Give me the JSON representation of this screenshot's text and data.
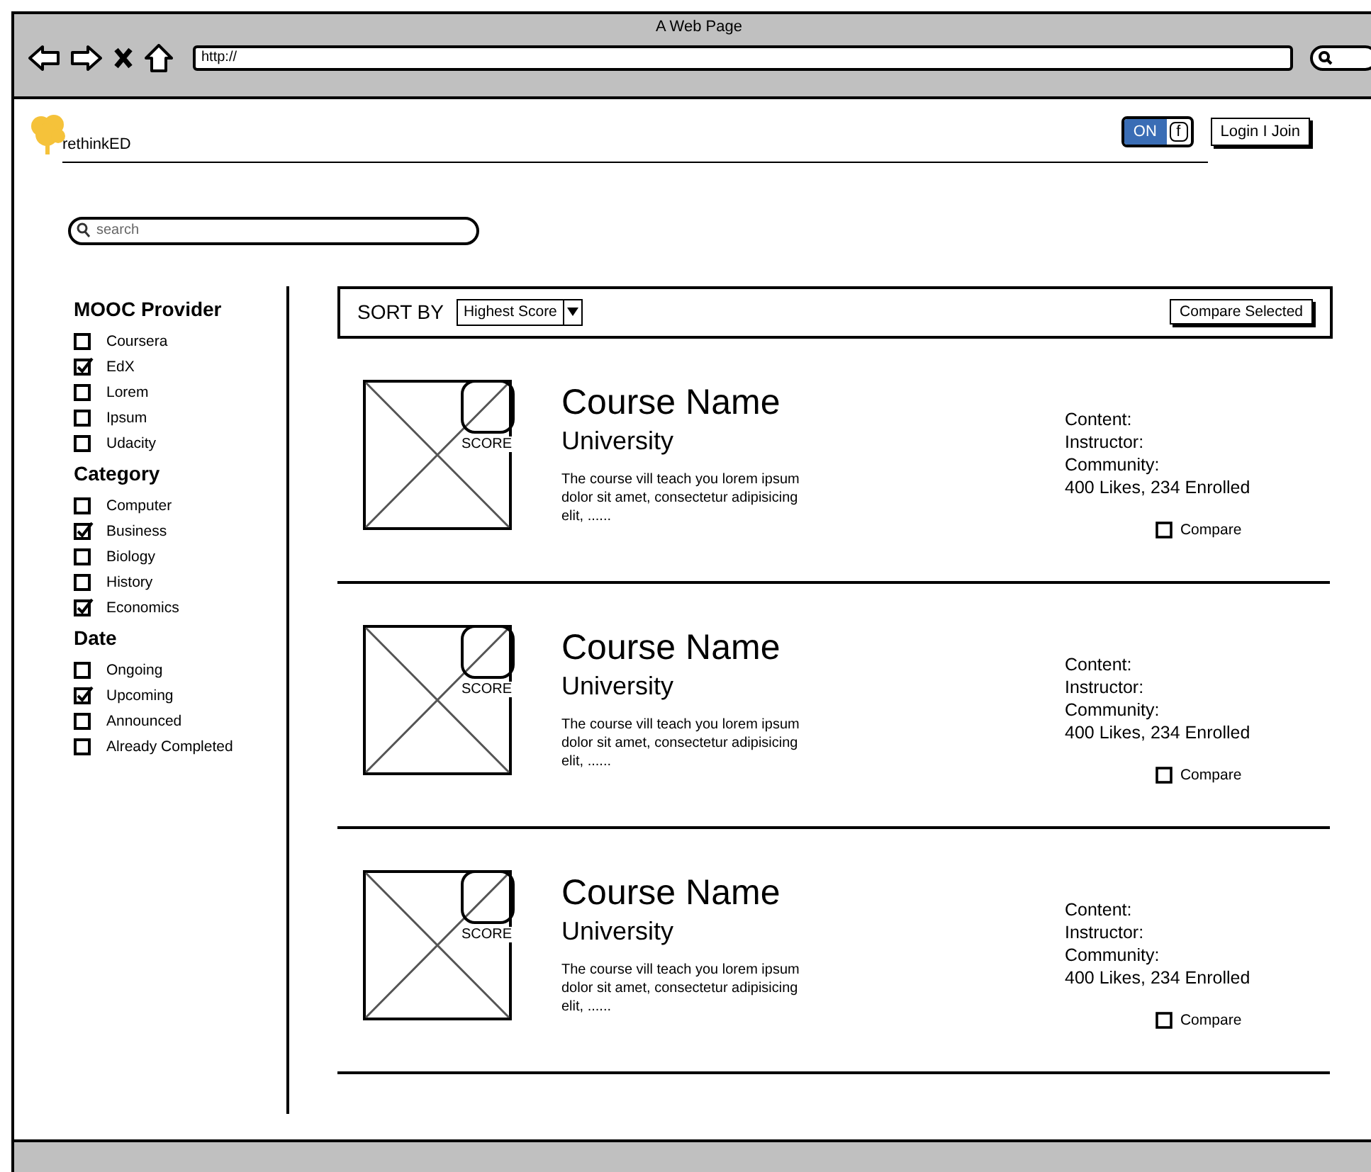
{
  "browser": {
    "title": "A Web Page",
    "url": "http://"
  },
  "header": {
    "logo_text": "rethinkED",
    "toggle": {
      "label": "ON",
      "on": true,
      "icon_text": "f"
    },
    "login_button": "Login I Join"
  },
  "search": {
    "placeholder": "search"
  },
  "filters": [
    {
      "title": "MOOC Provider",
      "options": [
        {
          "label": "Coursera",
          "checked": false
        },
        {
          "label": "EdX",
          "checked": true
        },
        {
          "label": "Lorem",
          "checked": false
        },
        {
          "label": "Ipsum",
          "checked": false
        },
        {
          "label": "Udacity",
          "checked": false
        }
      ]
    },
    {
      "title": "Category",
      "options": [
        {
          "label": "Computer",
          "checked": false
        },
        {
          "label": "Business",
          "checked": true
        },
        {
          "label": "Biology",
          "checked": false
        },
        {
          "label": "History",
          "checked": false
        },
        {
          "label": "Economics",
          "checked": true
        }
      ]
    },
    {
      "title": "Date",
      "options": [
        {
          "label": "Ongoing",
          "checked": false
        },
        {
          "label": "Upcoming",
          "checked": true
        },
        {
          "label": "Announced",
          "checked": false
        },
        {
          "label": "Already Completed",
          "checked": false
        }
      ]
    }
  ],
  "toolbar": {
    "sort_label": "SORT BY",
    "sort_value": "Highest Score",
    "compare_button": "Compare Selected"
  },
  "courses": [
    {
      "name": "Course Name",
      "university": "University",
      "description": "The course vill teach you lorem ipsum dolor sit amet, consectetur adipisicing elit, ......",
      "score_label": "SCORE",
      "content_label": "Content:",
      "instructor_label": "Instructor:",
      "community_label": "Community:",
      "stats": "400 Likes, 234 Enrolled",
      "compare_label": "Compare",
      "compare_checked": false
    },
    {
      "name": "Course Name",
      "university": "University",
      "description": "The course vill teach you lorem ipsum dolor sit amet, consectetur adipisicing elit, ......",
      "score_label": "SCORE",
      "content_label": "Content:",
      "instructor_label": "Instructor:",
      "community_label": "Community:",
      "stats": "400 Likes, 234 Enrolled",
      "compare_label": "Compare",
      "compare_checked": false
    },
    {
      "name": "Course Name",
      "university": "University",
      "description": "The course vill teach you lorem ipsum dolor sit amet, consectetur adipisicing elit, ......",
      "score_label": "SCORE",
      "content_label": "Content:",
      "instructor_label": "Instructor:",
      "community_label": "Community:",
      "stats": "400 Likes, 234 Enrolled",
      "compare_label": "Compare",
      "compare_checked": false
    }
  ]
}
